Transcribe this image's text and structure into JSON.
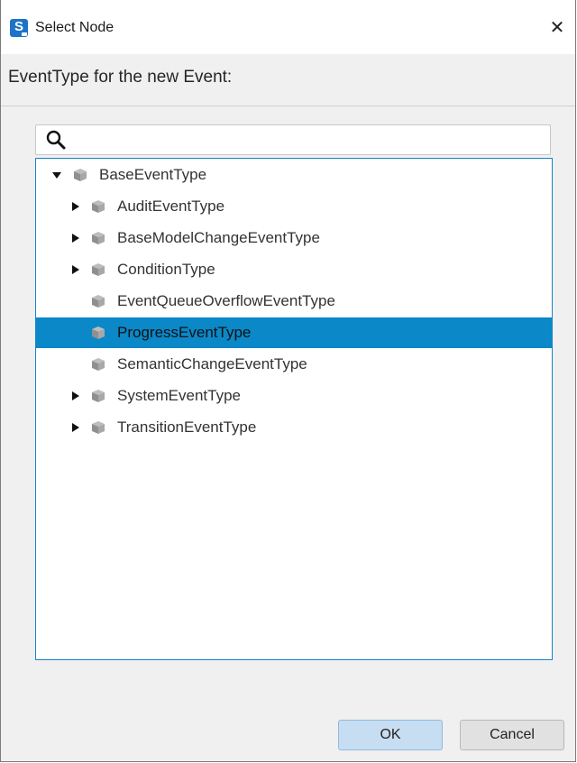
{
  "window": {
    "title": "Select Node",
    "app_icon_letter": "S",
    "close_symbol": "✕"
  },
  "header": {
    "prompt": "EventType for the new Event:"
  },
  "search": {
    "value": "",
    "icon": "search-icon"
  },
  "tree": {
    "root": {
      "label": "BaseEventType",
      "expanded": true
    },
    "children": [
      {
        "label": "AuditEventType",
        "has_children": true,
        "selected": false
      },
      {
        "label": "BaseModelChangeEventType",
        "has_children": true,
        "selected": false
      },
      {
        "label": "ConditionType",
        "has_children": true,
        "selected": false
      },
      {
        "label": "EventQueueOverflowEventType",
        "has_children": false,
        "selected": false
      },
      {
        "label": "ProgressEventType",
        "has_children": false,
        "selected": true
      },
      {
        "label": "SemanticChangeEventType",
        "has_children": false,
        "selected": false
      },
      {
        "label": "SystemEventType",
        "has_children": true,
        "selected": false
      },
      {
        "label": "TransitionEventType",
        "has_children": true,
        "selected": false
      }
    ]
  },
  "buttons": {
    "ok": "OK",
    "cancel": "Cancel"
  },
  "colors": {
    "selection": "#0a88c8",
    "tree_border": "#1585c7",
    "app_icon": "#1e73c8"
  }
}
